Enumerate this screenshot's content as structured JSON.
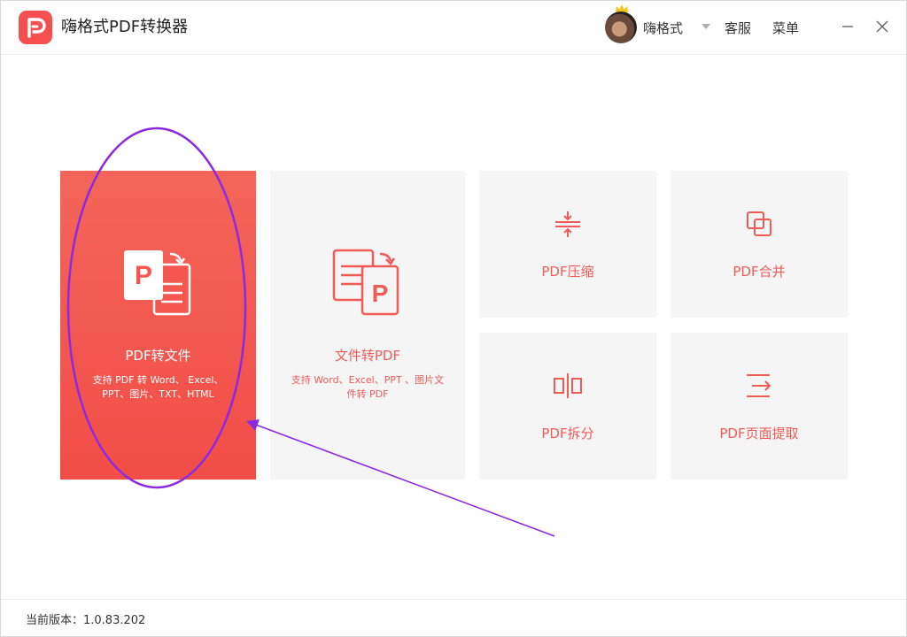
{
  "app": {
    "title": "嗨格式PDF转换器"
  },
  "header": {
    "username": "嗨格式",
    "service_label": "客服",
    "menu_label": "菜单"
  },
  "tiles": {
    "pdf_to_file": {
      "title": "PDF转文件",
      "desc_line1": "支持 PDF 转 Word、 Excel、",
      "desc_line2": "PPT、图片、TXT、HTML"
    },
    "file_to_pdf": {
      "title": "文件转PDF",
      "desc_line1": "支持 Word、Excel、PPT 、图片文",
      "desc_line2": "件转 PDF"
    },
    "compress": {
      "title": "PDF压缩"
    },
    "merge": {
      "title": "PDF合并"
    },
    "split": {
      "title": "PDF拆分"
    },
    "extract": {
      "title": "PDF页面提取"
    }
  },
  "footer": {
    "version": "当前版本：1.0.83.202"
  },
  "colors": {
    "accent": "#f3504f",
    "annotation": "#8a2be2",
    "tile_bg": "#f5f5f5"
  }
}
